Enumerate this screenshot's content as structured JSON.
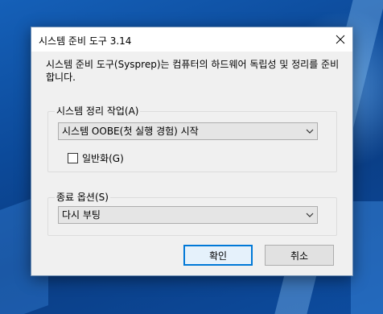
{
  "window": {
    "title": "시스템 준비 도구 3.14"
  },
  "description": "시스템 준비 도구(Sysprep)는 컴퓨터의 하드웨어 독립성 및 정리를 준비합니다.",
  "cleanup_group": {
    "legend": "시스템 정리 작업(A)",
    "selected_action": "시스템 OOBE(첫 실행 경험) 시작",
    "generalize_label": "일반화(G)",
    "generalize_checked": false
  },
  "shutdown_group": {
    "legend": "종료 옵션(S)",
    "selected_option": "다시 부팅"
  },
  "buttons": {
    "ok": "확인",
    "cancel": "취소"
  },
  "colors": {
    "accent": "#0078d7",
    "desktop": "#0c4a9a"
  },
  "icons": {
    "close": "close-icon",
    "dropdown": "chevron-down-icon"
  }
}
